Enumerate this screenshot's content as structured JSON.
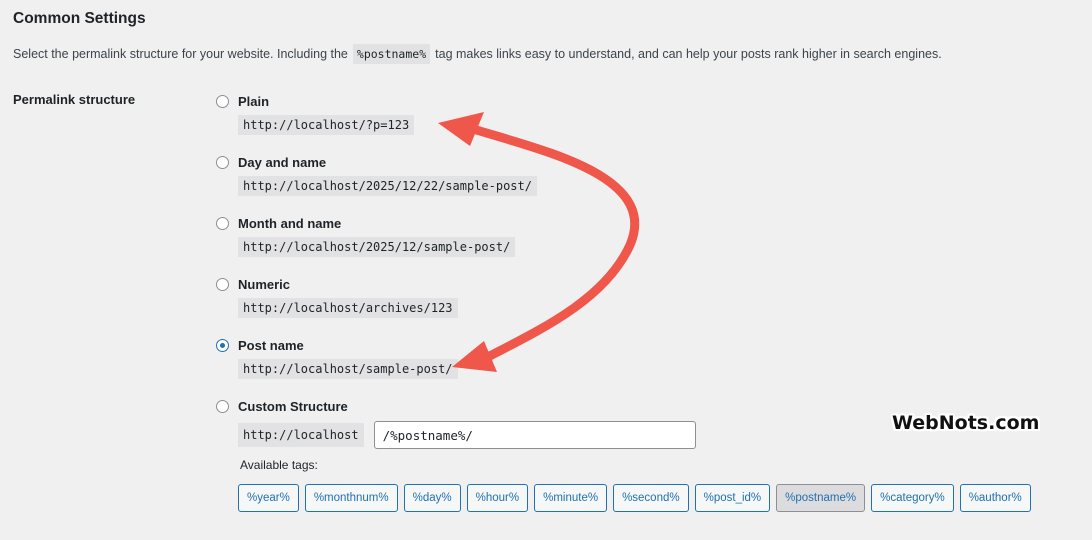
{
  "section": {
    "title": "Common Settings",
    "desc_before": "Select the permalink structure for your website. Including the",
    "desc_tag": "%postname%",
    "desc_after": "tag makes links easy to understand, and can help your posts rank higher in search engines."
  },
  "permalink": {
    "label": "Permalink structure",
    "options": [
      {
        "label": "Plain",
        "url": "http://localhost/?p=123",
        "checked": false
      },
      {
        "label": "Day and name",
        "url": "http://localhost/2025/12/22/sample-post/",
        "checked": false
      },
      {
        "label": "Month and name",
        "url": "http://localhost/2025/12/sample-post/",
        "checked": false
      },
      {
        "label": "Numeric",
        "url": "http://localhost/archives/123",
        "checked": false
      },
      {
        "label": "Post name",
        "url": "http://localhost/sample-post/",
        "checked": true
      }
    ],
    "custom": {
      "label": "Custom Structure",
      "base": "http://localhost",
      "value": "/%postname%/"
    },
    "available_tags_label": "Available tags:",
    "tags": [
      "%year%",
      "%monthnum%",
      "%day%",
      "%hour%",
      "%minute%",
      "%second%",
      "%post_id%",
      "%postname%",
      "%category%",
      "%author%"
    ],
    "active_tag": "%postname%"
  },
  "watermark": "WebNots.com",
  "colors": {
    "accent": "#2271b1",
    "arrow": "#f0574b",
    "background": "#f0f0f1"
  }
}
